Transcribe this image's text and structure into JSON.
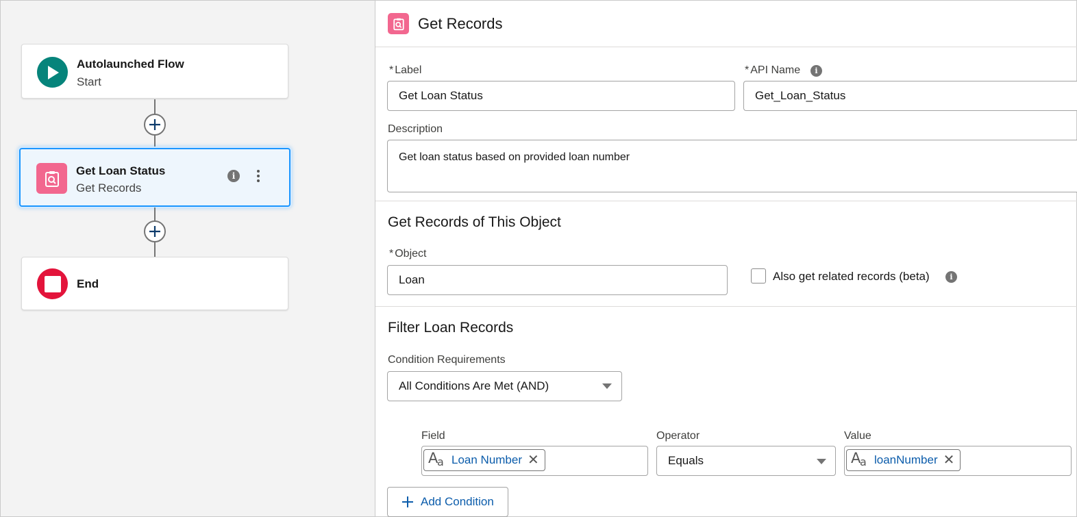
{
  "canvas": {
    "start_node": {
      "title": "Autolaunched Flow",
      "subtitle": "Start",
      "icon": "play-icon",
      "color": "#06847b"
    },
    "get_node": {
      "title": "Get Loan Status",
      "subtitle": "Get Records",
      "icon": "get-records-icon",
      "color": "#f2678f"
    },
    "end_node": {
      "title": "End",
      "icon": "stop-icon",
      "color": "#e3143b"
    }
  },
  "panel": {
    "header": {
      "title": "Get Records",
      "icon": "get-records-icon"
    },
    "label_field": {
      "required_mark": "*",
      "label": "Label",
      "value": "Get Loan Status"
    },
    "api_name_field": {
      "required_mark": "*",
      "label": "API Name",
      "value": "Get_Loan_Status"
    },
    "description_field": {
      "label": "Description",
      "value": "Get loan status based on provided loan number"
    },
    "object_section": {
      "title": "Get Records of This Object",
      "object_field": {
        "required_mark": "*",
        "label": "Object",
        "value": "Loan"
      },
      "related_checkbox": {
        "label": "Also get related records (beta)",
        "checked": false
      }
    },
    "filter_section": {
      "title": "Filter Loan Records",
      "condition_requirements": {
        "label": "Condition Requirements",
        "value": "All Conditions Are Met (AND)"
      },
      "columns": {
        "field": "Field",
        "operator": "Operator",
        "value": "Value"
      },
      "condition": {
        "field": "Loan Number",
        "operator": "Equals",
        "value": "loanNumber"
      },
      "add_condition_label": "Add Condition"
    }
  }
}
